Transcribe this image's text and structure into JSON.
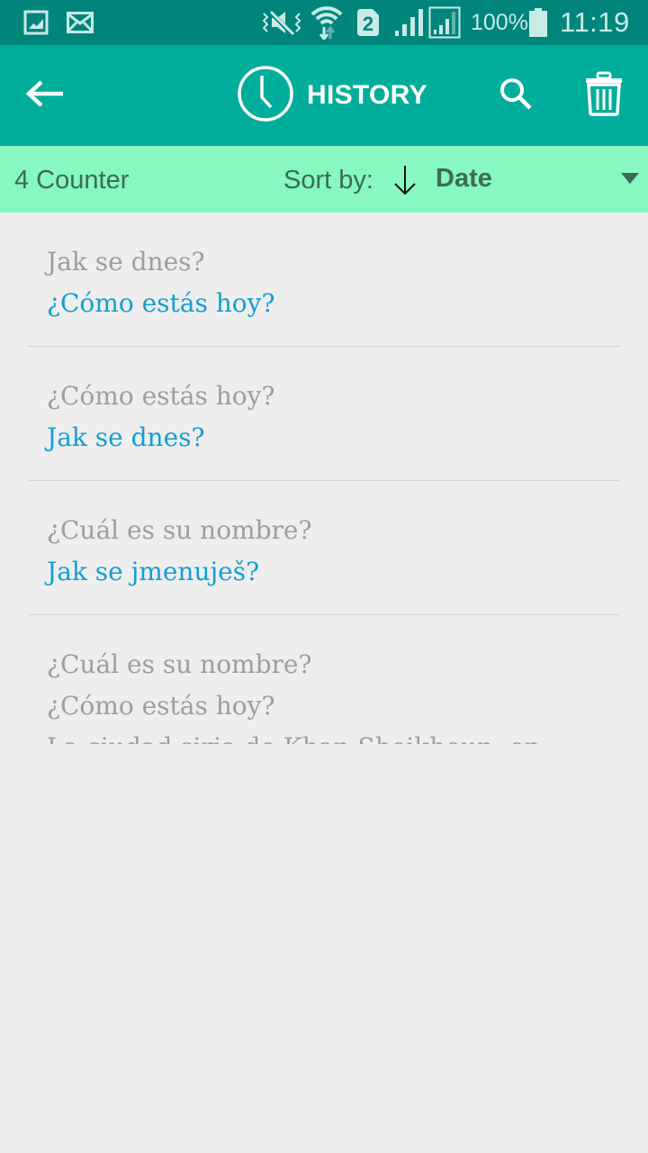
{
  "status_bar": {
    "left_icons": [
      "gallery-icon",
      "email-icon"
    ],
    "right_icons": [
      "vibrate-mute-icon",
      "wifi-icon",
      "sim2-icon",
      "signal-icon",
      "signal-boxed-icon",
      "battery-icon"
    ],
    "sim_label": "2",
    "battery": "100%",
    "time": "11:19"
  },
  "app_bar": {
    "title": "HISTORY",
    "back_icon": "arrow-left-icon",
    "title_icon": "clock-icon",
    "search_icon": "search-icon",
    "delete_icon": "trash-icon"
  },
  "sort_bar": {
    "counter": "4 Counter",
    "sort_label": "Sort by:",
    "sort_direction": "descending",
    "sort_value": "Date"
  },
  "history": [
    {
      "source": "Jak se dnes?",
      "translation": "¿Cómo estás hoy?"
    },
    {
      "source": "¿Cómo estás hoy?",
      "translation": "Jak se dnes?"
    },
    {
      "source": "¿Cuál es su nombre?",
      "translation": "Jak se jmenuješ?"
    },
    {
      "source": "¿Cuál es su nombre?",
      "translation": "¿Cómo estás hoy?",
      "extra": "La ciudad siria de Khan Sheikhoun, en"
    }
  ],
  "colors": {
    "status_bar": "#00857a",
    "app_bar": "#00ad9b",
    "sort_bar": "#86f8c0",
    "background": "#eeeeee",
    "source_text": "#9e9e9e",
    "translation_text": "#129fd2"
  }
}
